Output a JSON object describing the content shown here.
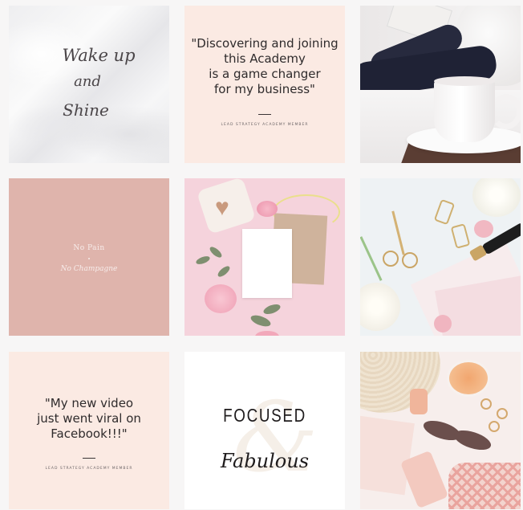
{
  "tiles": {
    "wake": {
      "line1": "Wake up",
      "line2": "and",
      "line3": "Shine"
    },
    "quote1": {
      "lines": [
        "\"Discovering and joining",
        "this Academy",
        "is a game changer",
        "for my business\""
      ],
      "attribution": "LEAD STRATEGY ACADEMY MEMBER"
    },
    "nopain": {
      "line1": "No Pain",
      "line2": "No Champagne"
    },
    "quote2": {
      "lines": [
        "\"My new video",
        "just went viral on",
        "Facebook!!!\""
      ],
      "attribution": "LEAD STRATEGY ACADEMY MEMBER"
    },
    "focused": {
      "word1": "FOCUSED",
      "ampersand": "&",
      "word2": "Fabulous"
    }
  },
  "colors": {
    "quote_bg": "#fbeae3",
    "nopain_bg": "#dfb4ac",
    "page_bg": "#f7f6f6"
  }
}
